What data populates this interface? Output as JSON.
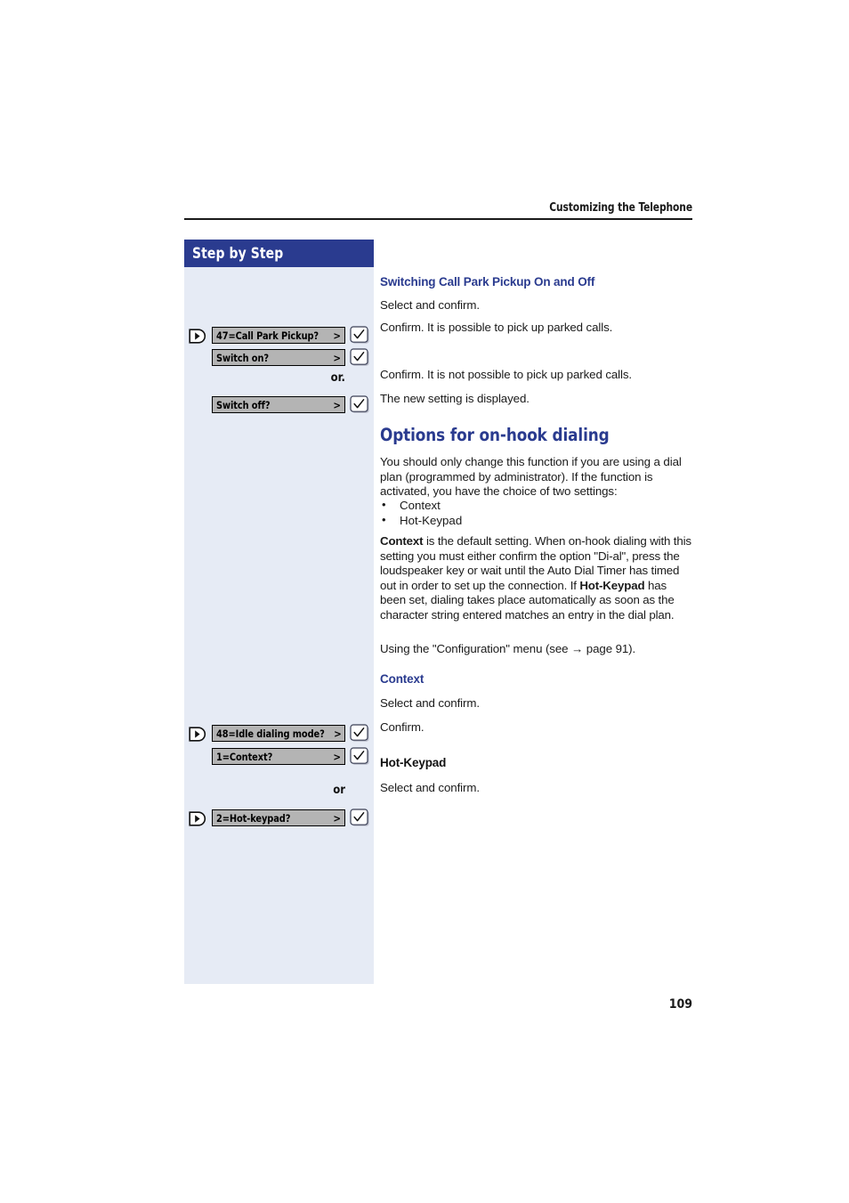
{
  "header": {
    "title": "Customizing the Telephone"
  },
  "sidebar": {
    "banner_label": "Step by Step",
    "rows": [
      {
        "display": "47=Call Park Pickup?",
        "caret": ">",
        "has_rocker": true,
        "has_confirm": true
      },
      {
        "display": "Switch on?",
        "caret": ">",
        "has_rocker": false,
        "has_confirm": true
      },
      {
        "display": "Switch off?",
        "caret": ">",
        "has_rocker": false,
        "has_confirm": true
      },
      {
        "display": "48=Idle dialing mode?",
        "caret": ">",
        "has_rocker": true,
        "has_confirm": true
      },
      {
        "display": "1=Context?",
        "caret": ">",
        "has_rocker": false,
        "has_confirm": true
      },
      {
        "display": "2=Hot-keypad?",
        "caret": ">",
        "has_rocker": true,
        "has_confirm": true
      }
    ],
    "or_first": "or.",
    "or_second": "or"
  },
  "content": {
    "section1_heading": "Switching Call Park Pickup On and Off",
    "line_select_confirm_1": "Select and confirm.",
    "line_confirm_possible": "Confirm. It is possible to pick up parked calls.",
    "line_confirm_not_possible": "Confirm. It is not possible to pick up parked calls.",
    "line_new_setting": "The new setting is displayed.",
    "section2_heading": "Options for on-hook dialing",
    "intro_paragraph": "You should only change this function if you are using a dial plan (programmed by administrator). If the function is activated, you have the choice of two settings:",
    "bullets": [
      "Context",
      "Hot-Keypad"
    ],
    "context_paragraph_part1": "Context",
    "context_paragraph_part2": " is the default setting. When on-hook dialing with this setting you must either confirm the option \"Di-al\", press the loudspeaker key or wait until the Auto Dial Timer has timed out in order to set up the connection. If ",
    "context_paragraph_part3": "Hot-Keypad",
    "context_paragraph_part4": " has been set, dialing takes place automatically as soon as the character string entered matches an entry in the dial plan.",
    "config_menu_line": "Using the \"Configuration\" menu (see → page 91).",
    "context_heading": "Context",
    "line_select_confirm_2": "Select and confirm.",
    "line_confirm": "Confirm.",
    "hotkeypad_heading": "Hot-Keypad",
    "line_select_confirm_3": "Select and confirm."
  },
  "footer": {
    "page_number": "109"
  },
  "colors": {
    "brand_navy": "#2a3b8f",
    "sidebar_bg": "#e6ebf5",
    "display_gray": "#b4b4b4"
  }
}
